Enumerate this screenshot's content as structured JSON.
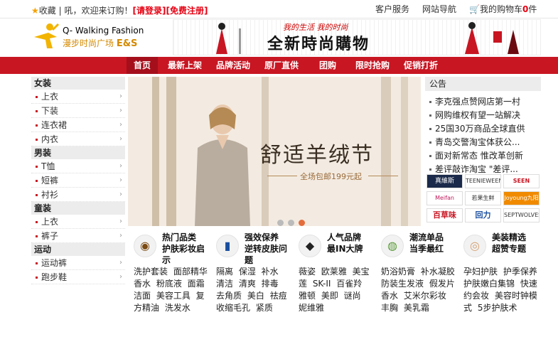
{
  "topbar": {
    "favorites": "收藏",
    "welcome": "| 吼，欢迎来订购！",
    "login": "[请登录]",
    "register": "[免费注册]",
    "service": "客户服务",
    "site_nav": "网站导航",
    "cart_prefix": "我的购物车",
    "cart_count": "0",
    "cart_suffix": "件"
  },
  "header": {
    "logo_line1": "Q- Walking Fashion",
    "logo_line2": "漫步时尚广场",
    "logo_es": "E&S",
    "banner_sub": "我的生活  我的时尚",
    "banner_title": "全新時尚購物"
  },
  "nav": [
    "首页",
    "最新上架",
    "品牌活动",
    "原厂直供",
    "团购",
    "限时抢购",
    "促销打折"
  ],
  "sidebar": [
    {
      "head": "女装",
      "items": [
        "上衣",
        "下装",
        "连衣裙",
        "内衣"
      ]
    },
    {
      "head": "男装",
      "items": [
        "T恤",
        "短裤",
        "衬衫"
      ]
    },
    {
      "head": "童装",
      "items": [
        "上衣",
        "裤子"
      ]
    },
    {
      "head": "运动",
      "items": [
        "运动裤",
        "跑步鞋"
      ]
    }
  ],
  "hero": {
    "title": "舒适羊绒节",
    "subtitle": "全场包邮199元起"
  },
  "notice": {
    "title": "公告",
    "items": [
      "李克强点赞网店第一村",
      "网购维权有望一站解决",
      "25国30万商品全球直供",
      "青岛交警淘宝体获公...",
      "面对新常态 惟改革创新",
      "差评敲诈淘宝 \"差评..."
    ]
  },
  "brands": [
    "真維斯",
    "TEENIEWEENIE",
    "SEEN",
    "Meifan",
    "若果生鲜",
    "Joyoung九阳",
    "百草味",
    "回力",
    "SEPTWOLVES"
  ],
  "columns": [
    {
      "icon": "cream-jar-icon",
      "glyph": "◉",
      "title": "热门品类 护肤彩妆启示",
      "body": "洗护套装  面部精华  香水  粉底液  面霜  洁面  美容工具  复方精油  洗发水"
    },
    {
      "icon": "serum-bottle-icon",
      "glyph": "▮",
      "title": "强效保养 逆转皮肤问题",
      "body": "隔离  保湿  补水  清洁  清爽  排毒  去角质  美白  祛痘  收缩毛孔  紧质"
    },
    {
      "icon": "compact-icon",
      "glyph": "◆",
      "title": "人气品牌 最IN大牌",
      "body": "薇姿  欧莱雅  美宝莲  SK-II  百雀羚  雅顿  美即  谜尚  妮维雅"
    },
    {
      "icon": "tube-icon",
      "glyph": "◍",
      "title": "潮流单品 当季最红",
      "body": "奶浴奶膏  补水凝胶  防装生发液  假发片  香水  艾米尔彩妆  丰胸  美乳霜"
    },
    {
      "icon": "cushion-icon",
      "glyph": "◎",
      "title": "美装精选 超赞专题",
      "body": "孕妇护肤  护季保养  护肤嫩白集锦  快速约会妆  美容时钟模式  5步护肤术"
    }
  ]
}
